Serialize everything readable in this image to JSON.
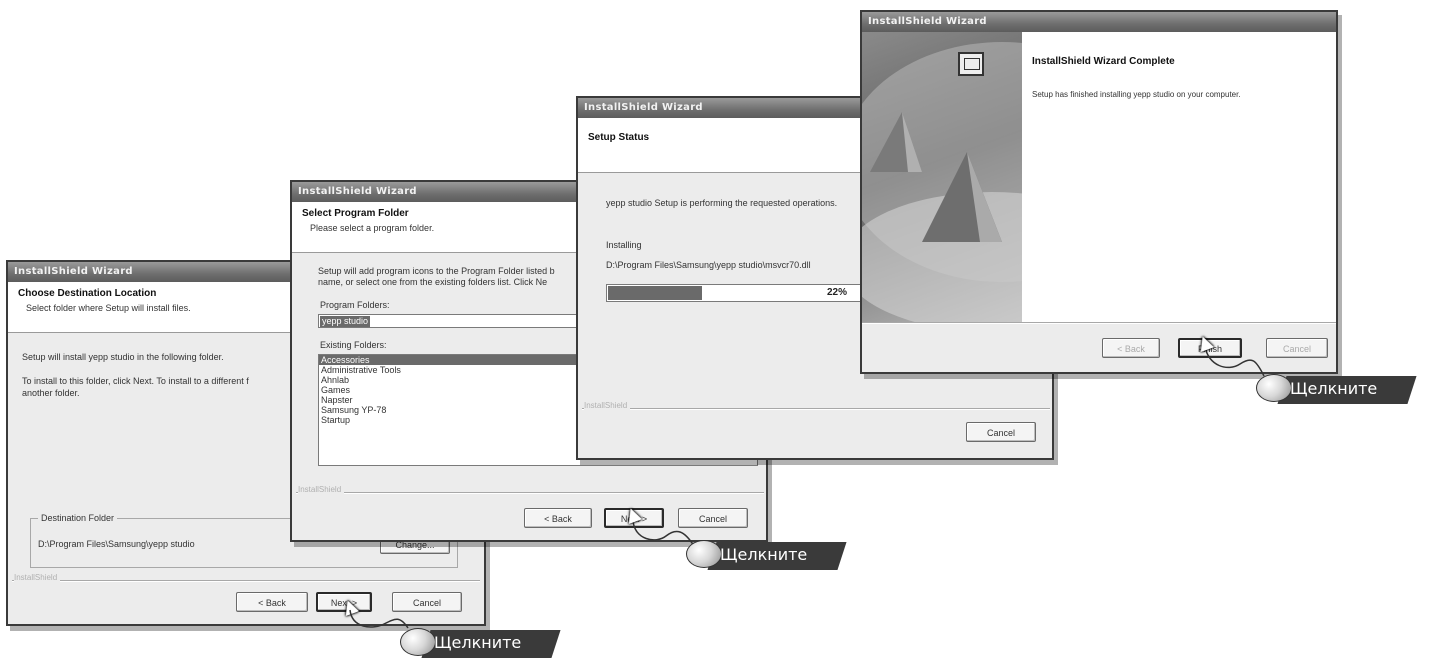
{
  "wizard_title": "InstallShield Wizard",
  "click_label": "Щелкните",
  "brand_label": "InstallShield",
  "buttons": {
    "back": "< Back",
    "next": "Next >",
    "cancel": "Cancel",
    "finish": "Finish",
    "change": "Change..."
  },
  "w1": {
    "title": "Choose Destination Location",
    "subtitle": "Select folder where Setup will install files.",
    "line1": "Setup will install yepp studio in the following folder.",
    "line2": "To install to this folder, click Next. To install to a different f",
    "line3": "another folder.",
    "group_label": "Destination Folder",
    "path": "D:\\Program Files\\Samsung\\yepp studio"
  },
  "w2": {
    "title": "Select Program Folder",
    "subtitle": "Please select a program folder.",
    "line1": "Setup will add program icons to the Program Folder listed b",
    "line2": "name, or select one from the existing folders list.  Click Ne",
    "program_folders_label": "Program Folders:",
    "program_folder_value": "yepp studio",
    "existing_label": "Existing Folders:",
    "folders": [
      "Accessories",
      "Administrative Tools",
      "Ahnlab",
      "Games",
      "Napster",
      "Samsung YP-78",
      "Startup"
    ]
  },
  "w3": {
    "title": "Setup Status",
    "line1": "yepp studio Setup is performing the requested operations.",
    "installing": "Installing",
    "file": "D:\\Program Files\\Samsung\\yepp studio\\msvcr70.dll",
    "progress": 0.22,
    "progress_text": "22%"
  },
  "w4": {
    "title": "InstallShield Wizard Complete",
    "line1": "Setup has finished installing yepp studio on your computer."
  }
}
